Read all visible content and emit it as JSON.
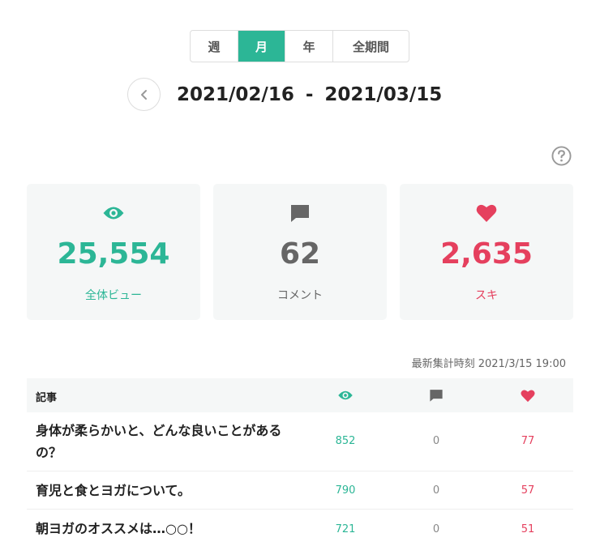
{
  "period_tabs": [
    {
      "label": "週",
      "active": false
    },
    {
      "label": "月",
      "active": true
    },
    {
      "label": "年",
      "active": false
    },
    {
      "label": "全期間",
      "active": false
    }
  ],
  "date_range": {
    "start": "2021/02/16",
    "separator": "-",
    "end": "2021/03/15"
  },
  "summary": {
    "views": {
      "value": "25,554",
      "label": "全体ビュー",
      "icon": "eye-icon"
    },
    "comments": {
      "value": "62",
      "label": "コメント",
      "icon": "comment-icon"
    },
    "likes": {
      "value": "2,635",
      "label": "スキ",
      "icon": "heart-icon"
    }
  },
  "last_updated": "最新集計時刻 2021/3/15 19:00",
  "table": {
    "header_title": "記事",
    "rows": [
      {
        "title": "身体が柔らかいと、どんな良いことがあるの？",
        "views": "852",
        "comments": "0",
        "likes": "77"
      },
      {
        "title": "育児と食とヨガについて。",
        "views": "790",
        "comments": "0",
        "likes": "57"
      },
      {
        "title": "朝ヨガのオススメは…○○！",
        "views": "721",
        "comments": "0",
        "likes": "51"
      }
    ]
  },
  "colors": {
    "accent": "#2cb696",
    "like": "#e5405e",
    "neutral": "#666666",
    "card_bg": "#f5f7f7"
  }
}
